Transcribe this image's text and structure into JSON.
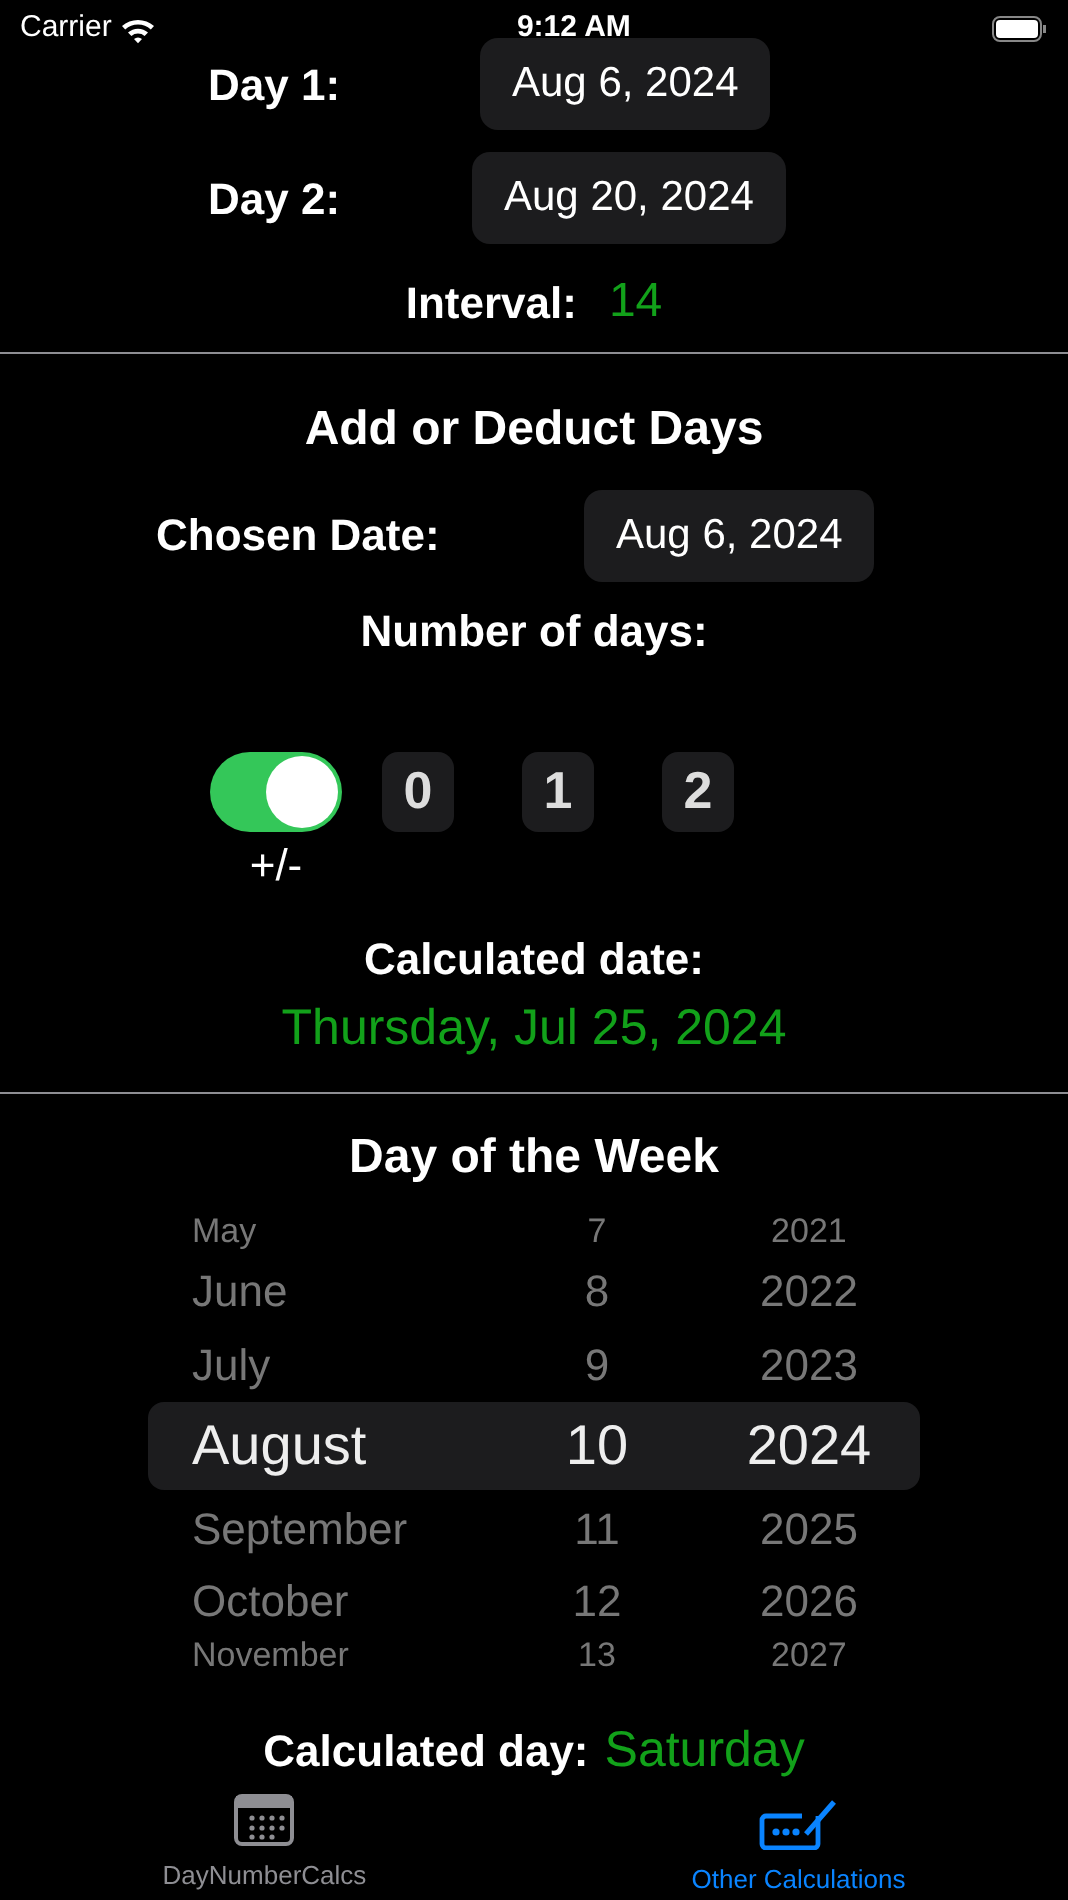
{
  "status_bar": {
    "carrier": "Carrier",
    "time": "9:12 AM"
  },
  "interval_section": {
    "rows": [
      {
        "label": "Day 1:",
        "value": "Aug 6, 2024"
      },
      {
        "label": "Day 2:",
        "value": "Aug 20, 2024"
      }
    ],
    "interval_label": "Interval:",
    "interval_value": "14"
  },
  "add_section": {
    "title": "Add or Deduct Days",
    "chosen_label": "Chosen Date:",
    "chosen_value": "Aug 6, 2024",
    "days_label": "Number of days:",
    "sign_toggle": {
      "on": true,
      "label": "+/-"
    },
    "digit_wheels": [
      {
        "value": "0"
      },
      {
        "value": "1"
      },
      {
        "value": "2"
      }
    ],
    "result_label": "Calculated date:",
    "result_value": "Thursday, Jul 25, 2024"
  },
  "weekday_section": {
    "title": "Day of the Week",
    "picker_rows": [
      {
        "month": "May",
        "day": "7",
        "year": "2021",
        "selected": false
      },
      {
        "month": "June",
        "day": "8",
        "year": "2022",
        "selected": false
      },
      {
        "month": "July",
        "day": "9",
        "year": "2023",
        "selected": false
      },
      {
        "month": "August",
        "day": "10",
        "year": "2024",
        "selected": true
      },
      {
        "month": "September",
        "day": "11",
        "year": "2025",
        "selected": false
      },
      {
        "month": "October",
        "day": "12",
        "year": "2026",
        "selected": false
      },
      {
        "month": "November",
        "day": "13",
        "year": "2027",
        "selected": false
      }
    ],
    "result_label": "Calculated day:",
    "result_value": "Saturday"
  },
  "tab_bar": [
    {
      "label": "DayNumberCalcs",
      "selected": false
    },
    {
      "label": "Other Calculations",
      "selected": true
    }
  ]
}
